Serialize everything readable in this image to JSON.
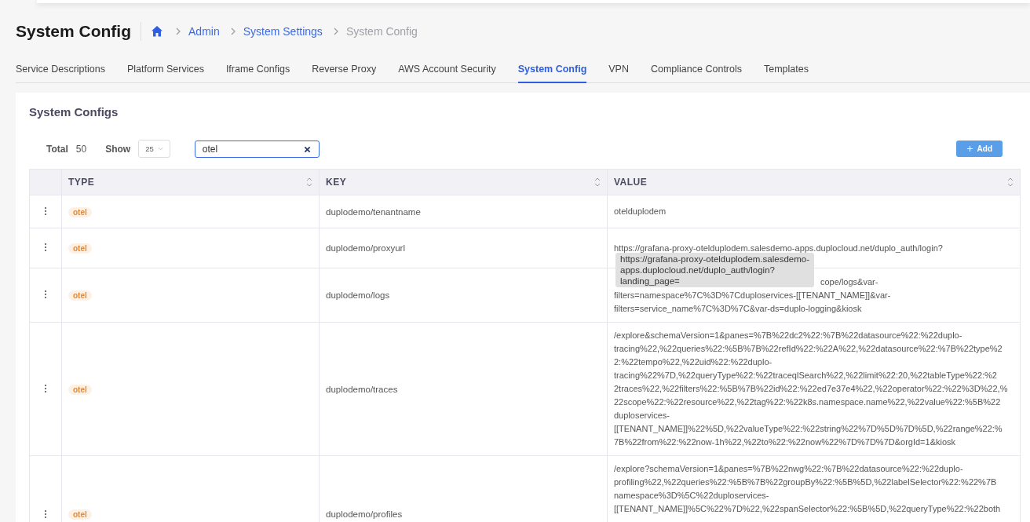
{
  "page_title": "System Config",
  "breadcrumb": [
    {
      "label": "Admin",
      "kind": "link"
    },
    {
      "label": "System Settings",
      "kind": "link"
    },
    {
      "label": "System Config",
      "kind": "current"
    }
  ],
  "tabs": [
    {
      "label": "Service Descriptions",
      "selected": false
    },
    {
      "label": "Platform Services",
      "selected": false
    },
    {
      "label": "Iframe Configs",
      "selected": false
    },
    {
      "label": "Reverse Proxy",
      "selected": false
    },
    {
      "label": "AWS Account Security",
      "selected": false
    },
    {
      "label": "System Config",
      "selected": true
    },
    {
      "label": "VPN",
      "selected": false
    },
    {
      "label": "Compliance Controls",
      "selected": false
    },
    {
      "label": "Templates",
      "selected": false
    }
  ],
  "card": {
    "title": "System Configs",
    "total_label": "Total",
    "total": "50",
    "show_label": "Show",
    "page_size": "25",
    "search": {
      "value": "otel"
    },
    "add_button": "Add"
  },
  "table": {
    "columns": [
      "TYPE",
      "KEY",
      "VALUE"
    ],
    "rows": [
      {
        "type": "otel",
        "key": "duplodemo/tenantname",
        "value_lines": [
          "otelduplodem"
        ]
      },
      {
        "type": "otel",
        "key": "duplodemo/proxyurl",
        "value_lines": [
          "https://grafana-proxy-otelduplodem.salesdemo-apps.duplocloud.net/duplo_auth/login?"
        ]
      },
      {
        "type": "otel",
        "key": "duplodemo/logs",
        "value_lines": [
          "cope/logs&var-",
          "filters=namespace%7C%3D%7Cduploservices-[[TENANT_NAME]]&var-",
          "filters=service_name%7C%3D%7C&var-ds=duplo-logging&kiosk"
        ],
        "first_line_partly_hidden": true
      },
      {
        "type": "otel",
        "key": "duplodemo/traces",
        "value_lines": [
          "/explore&schemaVersion=1&panes=%7B%22dc2%22:%7B%22datasource%22:%22duplo-",
          "tracing%22,%22queries%22:%5B%7B%22refId%22:%22A%22,%22datasource%22:%7B%22type%2",
          "2:%22tempo%22,%22uid%22:%22duplo-",
          "tracing%22%7D,%22queryType%22:%22traceqlSearch%22,%22limit%22:20,%22tableType%22:%2",
          "2traces%22,%22filters%22:%5B%7B%22id%22:%22ed7e37e4%22,%22operator%22:%22%3D%22,%",
          "22scope%22:%22resource%22,%22tag%22:%22k8s.namespace.name%22,%22value%22:%5B%22",
          "duploservices-",
          "[[TENANT_NAME]]%22%5D,%22valueType%22:%22string%22%7D%5D%7D%5D,%22range%22:%",
          "7B%22from%22:%22now-1h%22,%22to%22:%22now%22%7D%7D%7D&orgId=1&kiosk"
        ]
      },
      {
        "type": "otel",
        "key": "duplodemo/profiles",
        "value_lines": [
          "/explore?schemaVersion=1&panes=%7B%22nwg%22:%7B%22datasource%22:%22duplo-",
          "profiling%22,%22queries%22:%5B%7B%22groupBy%22:%5B%5D,%22labelSelector%22:%22%7B",
          "namespace%3D%5C%22duploservices-",
          "[[TENANT_NAME]]%5C%22%7D%22,%22spanSelector%22:%5B%5D,%22queryType%22:%22both"
        ]
      }
    ]
  },
  "tooltip": {
    "lines": [
      "https://grafana-proxy-otelduplodem.salesdemo-",
      "apps.duplocloud.net/duplo_auth/login?",
      "landing_page="
    ]
  }
}
